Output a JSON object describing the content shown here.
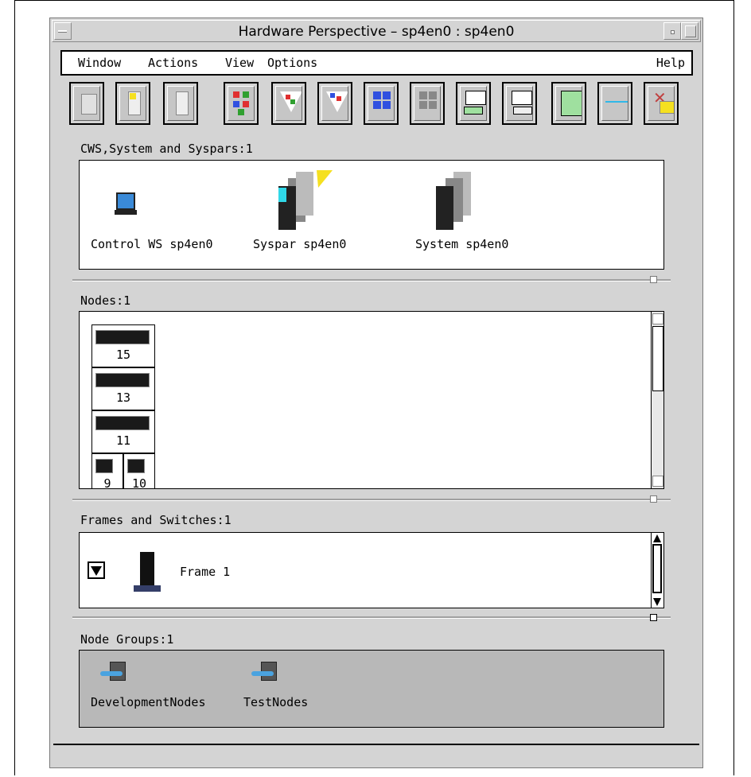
{
  "window": {
    "title": "Hardware Perspective – sp4en0 : sp4en0"
  },
  "menubar": {
    "items": [
      "Window",
      "Actions",
      "View",
      "Options"
    ],
    "help": "Help"
  },
  "toolbar": {
    "buttons": [
      {
        "icon": "notebook-icon"
      },
      {
        "icon": "open-node-icon"
      },
      {
        "icon": "close-node-icon"
      },
      {
        "icon": "shapes-grid-icon"
      },
      {
        "icon": "filter-funnel-icon"
      },
      {
        "icon": "filter-funnel-alt-icon"
      },
      {
        "icon": "select-all-icon"
      },
      {
        "icon": "deselect-icon"
      },
      {
        "icon": "monitor-export-icon"
      },
      {
        "icon": "monitor-import-icon"
      },
      {
        "icon": "table-view-icon"
      },
      {
        "icon": "graph-monitor-icon"
      },
      {
        "icon": "delete-check-icon"
      }
    ]
  },
  "cws_section": {
    "label": "CWS,System and Syspars:1",
    "items": [
      {
        "label": "Control WS sp4en0",
        "icon": "workstation-icon"
      },
      {
        "label": "Syspar sp4en0",
        "icon": "syspar-icon"
      },
      {
        "label": "System sp4en0",
        "icon": "system-icon"
      }
    ]
  },
  "nodes_section": {
    "label": "Nodes:1",
    "nodes": [
      "15",
      "13",
      "11"
    ],
    "partial_nodes": [
      "9",
      "10"
    ]
  },
  "frames_section": {
    "label": "Frames and Switches:1",
    "frame_label": "Frame 1"
  },
  "node_groups_section": {
    "label": "Node Groups:1",
    "groups": [
      {
        "label": "DevelopmentNodes"
      },
      {
        "label": "TestNodes"
      }
    ]
  },
  "colors": {
    "window_bg": "#d4d4d4",
    "pane_bg": "#ffffff",
    "groups_bg": "#b8b8b8",
    "lightning": "#f5e020",
    "cyan": "#30d8e8"
  }
}
